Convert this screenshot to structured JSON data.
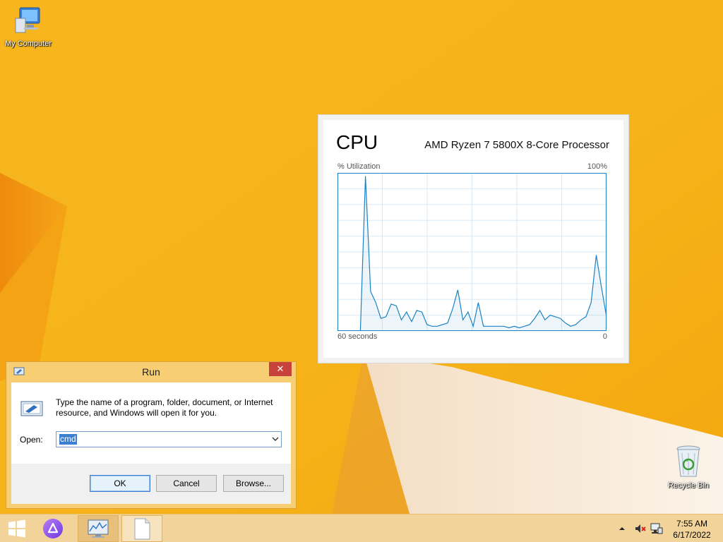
{
  "desktop": {
    "icons": [
      {
        "label": "My Computer",
        "icon": "computer-icon"
      },
      {
        "label": "Recycle Bin",
        "icon": "recycle-bin-icon"
      }
    ],
    "wallpaper_color": "#f6b51a"
  },
  "cpu_widget": {
    "title": "CPU",
    "processor": "AMD Ryzen 7 5800X 8-Core Processor",
    "utilization_label": "% Utilization",
    "max_label": "100%",
    "time_label": "60 seconds",
    "min_label": "0",
    "line_color": "#1c82c3",
    "chart_data": {
      "type": "area",
      "title": "CPU",
      "ylabel": "% Utilization",
      "ylim": [
        0,
        100
      ],
      "x_range_label": "60 seconds",
      "values": [
        0,
        98,
        25,
        18,
        8,
        9,
        17,
        16,
        7,
        12,
        6,
        13,
        12,
        4,
        3,
        3,
        4,
        5,
        14,
        26,
        7,
        12,
        3,
        18,
        3,
        3,
        3,
        3,
        3,
        2,
        3,
        2,
        3,
        4,
        8,
        13,
        7,
        10,
        9,
        8,
        5,
        3,
        4,
        7,
        9,
        18,
        48,
        28,
        9
      ]
    }
  },
  "run_dialog": {
    "title": "Run",
    "description": "Type the name of a program, folder, document, or Internet resource, and Windows will open it for you.",
    "open_label": "Open:",
    "input_value": "cmd",
    "buttons": {
      "ok": "OK",
      "cancel": "Cancel",
      "browse": "Browse..."
    }
  },
  "taskbar": {
    "clock_time": "7:55 AM",
    "clock_date": "6/17/2022",
    "apps": [
      "performance-monitor-icon",
      "blank-document-icon"
    ],
    "tray_icons": [
      "show-hidden-icons-arrow",
      "volume-muted-icon",
      "network-icon"
    ]
  }
}
